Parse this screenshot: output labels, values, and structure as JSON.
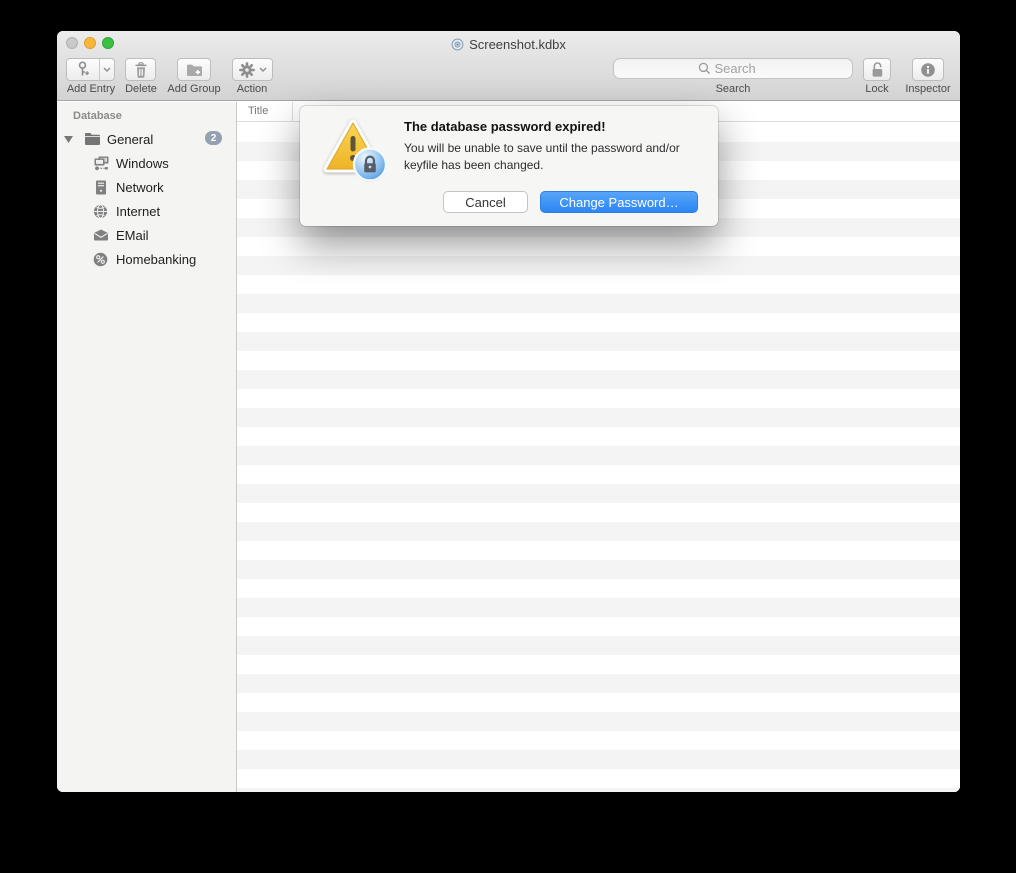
{
  "window": {
    "title": "Screenshot.kdbx"
  },
  "toolbar": {
    "add_entry": {
      "label": "Add Entry",
      "icon": "key-plus-icon"
    },
    "delete": {
      "label": "Delete",
      "icon": "trash-icon"
    },
    "add_group": {
      "label": "Add Group",
      "icon": "folder-plus-icon"
    },
    "action": {
      "label": "Action",
      "icon": "gear-icon"
    },
    "search": {
      "placeholder": "Search",
      "label": "Search",
      "icon": "magnifier-icon"
    },
    "lock": {
      "label": "Lock",
      "icon": "padlock-open-icon"
    },
    "inspector": {
      "label": "Inspector",
      "icon": "info-circle-icon"
    }
  },
  "sidebar": {
    "header": "Database",
    "group": {
      "label": "General",
      "badge": "2",
      "icon": "folder-icon",
      "expanded": true
    },
    "items": [
      {
        "label": "Windows",
        "icon": "workgroup-icon"
      },
      {
        "label": "Network",
        "icon": "server-icon"
      },
      {
        "label": "Internet",
        "icon": "globe-icon"
      },
      {
        "label": "EMail",
        "icon": "envelope-icon"
      },
      {
        "label": "Homebanking",
        "icon": "percent-circle-icon"
      }
    ]
  },
  "entry_list": {
    "column_header": "Title"
  },
  "alert": {
    "title": "The database password expired!",
    "message_line1": "You will be unable to save until the password and/or",
    "message_line2": "keyfile has been changed.",
    "cancel_label": "Cancel",
    "confirm_label": "Change Password…",
    "icon": "warning-lock-icon"
  },
  "colors": {
    "accent_blue": "#3b8df4",
    "warning_yellow": "#f0bd35",
    "badge_gray_blue": "#94a1b0",
    "traffic_close": "#c9c9c9",
    "traffic_minimize": "#f6b73f",
    "traffic_zoom": "#3cc043"
  }
}
